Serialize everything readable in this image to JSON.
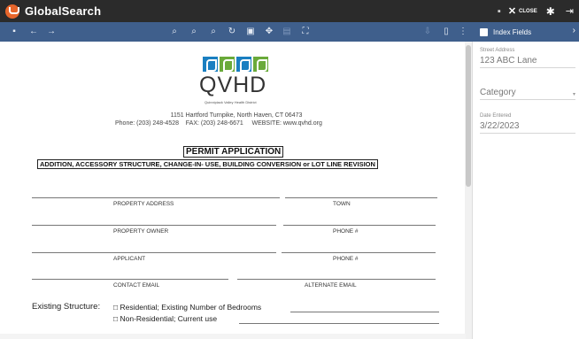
{
  "app": {
    "name": "GlobalSearch",
    "close_label": "CLOSE"
  },
  "panel": {
    "title": "Index Fields",
    "fields": [
      {
        "label": "Street Address",
        "value": "123 ABC Lane"
      },
      {
        "label": "",
        "value": "Category"
      },
      {
        "label": "Date Entered",
        "value": "3/22/2023"
      }
    ]
  },
  "document": {
    "org_abbr": "QVHD",
    "org_full": "Quinnipiack Valley Health District",
    "address": "1151 Hartford Turnpike, North Haven, CT 06473",
    "contact": "Phone: (203) 248-4528    FAX: (203) 248-6671     WEBSITE: www.qvhd.org",
    "title": "PERMIT APPLICATION",
    "subtitle": "ADDITION, ACCESSORY STRUCTURE, CHANGE-IN- USE, BUILDING CONVERSION or LOT LINE REVISION",
    "fields": {
      "property_address": "PROPERTY ADDRESS",
      "town": "TOWN",
      "property_owner": "PROPERTY OWNER",
      "phone1": "PHONE #",
      "applicant": "APPLICANT",
      "phone2": "PHONE #",
      "contact_email": "CONTACT EMAIL",
      "alternate_email": "ALTERNATE EMAIL"
    },
    "existing_label": "Existing Structure:",
    "opt_residential": "□ Residential; Existing Number of Bedrooms",
    "opt_nonresidential": "□ Non-Residential; Current use",
    "logo_colors": [
      "#1a7fc1",
      "#6aaa3a",
      "#1a7fc1",
      "#6aaa3a"
    ]
  },
  "colors": {
    "titlebar": "#2b2b2b",
    "toolbar": "#3f5f8c",
    "brand": "#e8662b"
  }
}
